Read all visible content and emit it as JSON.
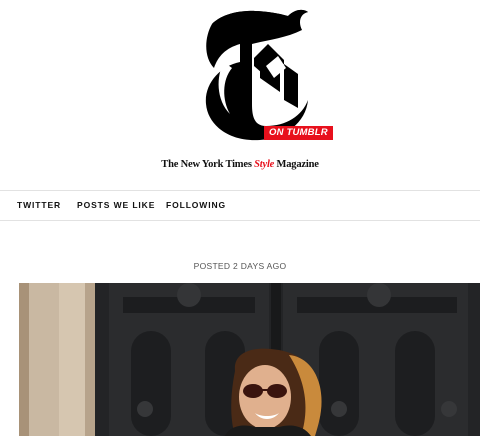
{
  "header": {
    "logo_letter": "T",
    "badge_label": "ON TUMBLR",
    "masthead": {
      "part1": "The New York Times ",
      "style_word": "Style",
      "part2": " Magazine"
    }
  },
  "nav": {
    "items": [
      {
        "label": "TWITTER"
      },
      {
        "label": "POSTS WE LIKE"
      },
      {
        "label": "FOLLOWING"
      }
    ]
  },
  "post": {
    "posted_label": "POSTED 2 DAYS AGO"
  },
  "colors": {
    "accent": "#e8101c",
    "text": "#111111",
    "divider": "#e2e2e2"
  }
}
